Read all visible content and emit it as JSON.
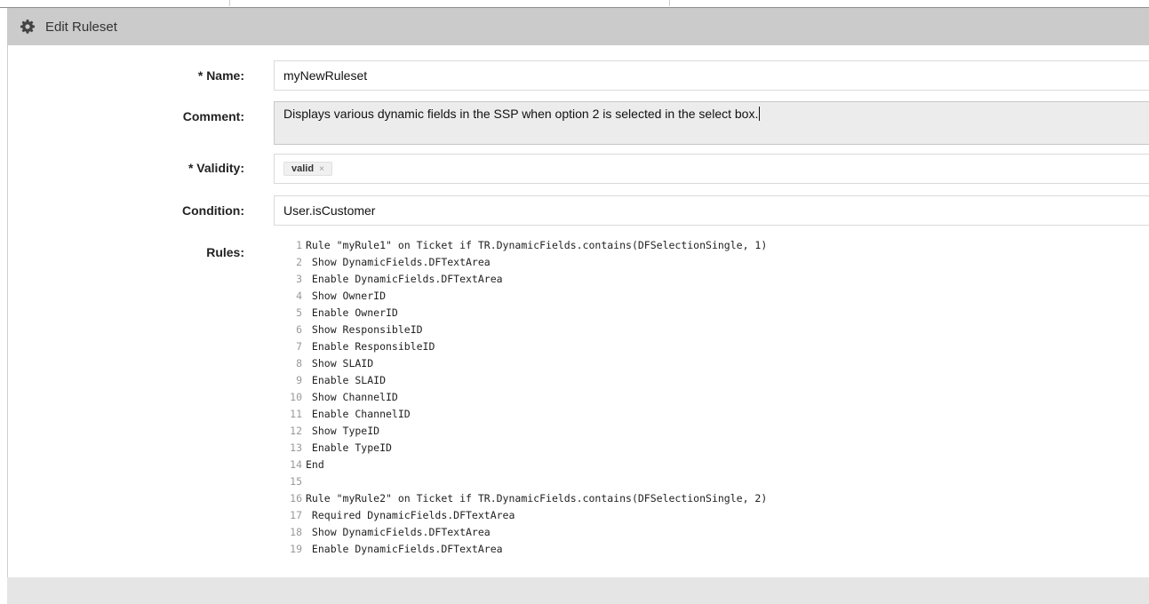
{
  "header": {
    "title": "Edit Ruleset",
    "icon": "gear-icon"
  },
  "form": {
    "name": {
      "label": "* Name:",
      "value": "myNewRuleset"
    },
    "comment": {
      "label": "Comment:",
      "value": "Displays various dynamic fields in the SSP when option 2 is selected in the select box."
    },
    "validity": {
      "label": "* Validity:",
      "token": "valid",
      "remove": "×"
    },
    "condition": {
      "label": "Condition:",
      "value": "User.isCustomer"
    },
    "rules": {
      "label": "Rules:"
    }
  },
  "code_lines": [
    {
      "n": "1",
      "t": "Rule \"myRule1\" on Ticket if TR.DynamicFields.contains(DFSelectionSingle, 1)"
    },
    {
      "n": "2",
      "t": " Show DynamicFields.DFTextArea"
    },
    {
      "n": "3",
      "t": " Enable DynamicFields.DFTextArea"
    },
    {
      "n": "4",
      "t": " Show OwnerID"
    },
    {
      "n": "5",
      "t": " Enable OwnerID"
    },
    {
      "n": "6",
      "t": " Show ResponsibleID"
    },
    {
      "n": "7",
      "t": " Enable ResponsibleID"
    },
    {
      "n": "8",
      "t": " Show SLAID"
    },
    {
      "n": "9",
      "t": " Enable SLAID"
    },
    {
      "n": "10",
      "t": " Show ChannelID"
    },
    {
      "n": "11",
      "t": " Enable ChannelID"
    },
    {
      "n": "12",
      "t": " Show TypeID"
    },
    {
      "n": "13",
      "t": " Enable TypeID"
    },
    {
      "n": "14",
      "t": "End"
    },
    {
      "n": "15",
      "t": ""
    },
    {
      "n": "16",
      "t": "Rule \"myRule2\" on Ticket if TR.DynamicFields.contains(DFSelectionSingle, 2)"
    },
    {
      "n": "17",
      "t": " Required DynamicFields.DFTextArea"
    },
    {
      "n": "18",
      "t": " Show DynamicFields.DFTextArea"
    },
    {
      "n": "19",
      "t": " Enable DynamicFields.DFTextArea"
    }
  ]
}
